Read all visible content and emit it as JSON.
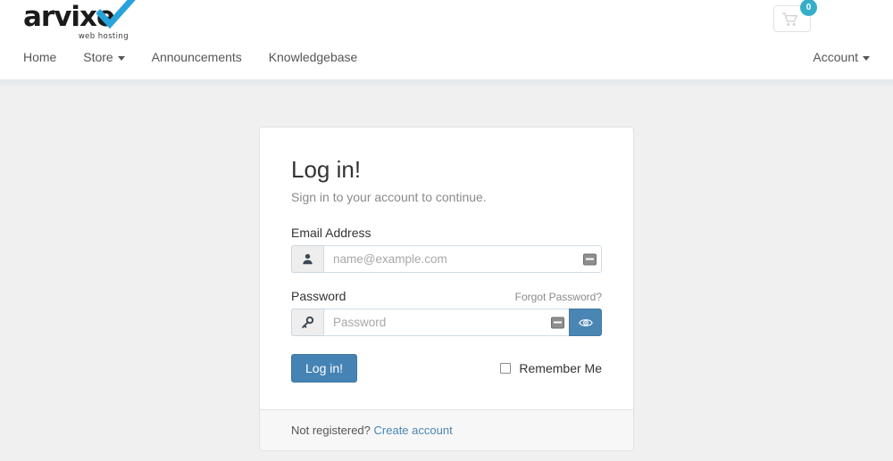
{
  "header": {
    "logo": {
      "word": "arvixe",
      "tagline": "web hosting",
      "check_icon": "checkmark-icon",
      "accent_color": "#29a3dc"
    },
    "cart": {
      "icon": "shopping-cart-icon",
      "count": "0",
      "badge_color": "#35afc8"
    }
  },
  "nav": {
    "left_items": [
      {
        "label": "Home",
        "has_caret": false
      },
      {
        "label": "Store",
        "has_caret": true
      },
      {
        "label": "Announcements",
        "has_caret": false
      },
      {
        "label": "Knowledgebase",
        "has_caret": false
      }
    ],
    "right_items": [
      {
        "label": "Account",
        "has_caret": true
      }
    ]
  },
  "login_card": {
    "title": "Log in!",
    "subtitle": "Sign in to your account to continue.",
    "email": {
      "label": "Email Address",
      "placeholder": "name@example.com",
      "value": "",
      "addon_icon": "user-icon",
      "autofill_icon": "autofill-icon"
    },
    "password": {
      "label": "Password",
      "forgot_label": "Forgot Password?",
      "placeholder": "Password",
      "value": "",
      "addon_icon": "key-icon",
      "autofill_icon": "autofill-icon",
      "toggle_icon": "eye-icon",
      "toggle_color": "#4a86b4"
    },
    "submit_label": "Log in!",
    "submit_color": "#4583b4",
    "remember_label": "Remember Me",
    "remember_checked": false,
    "footer": {
      "text": "Not registered?",
      "link_label": "Create account",
      "link_color": "#4a86b4"
    }
  }
}
